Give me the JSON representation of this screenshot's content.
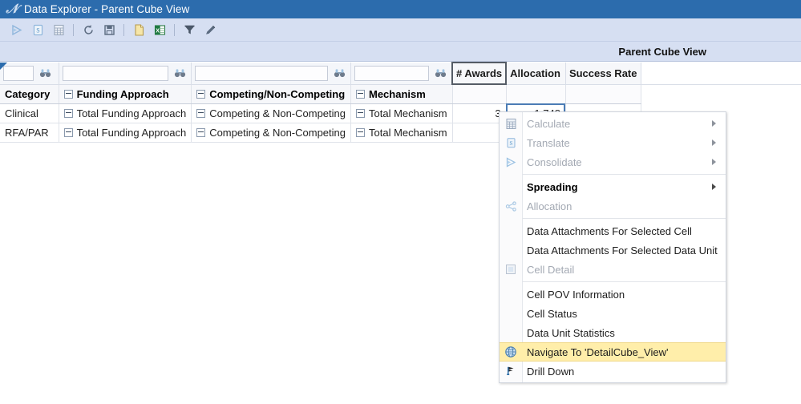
{
  "window": {
    "title": "Data Explorer - Parent Cube View",
    "logo_icon": "stylized-d-logo-icon"
  },
  "toolbar": {
    "buttons": [
      {
        "name": "consolidate-icon",
        "label": "Consolidate"
      },
      {
        "name": "translate-icon",
        "label": "Translate"
      },
      {
        "name": "calculate-icon",
        "label": "Calculate"
      },
      {
        "name": "refresh-icon",
        "label": "Refresh"
      },
      {
        "name": "save-icon",
        "label": "Save"
      },
      {
        "name": "export-document-icon",
        "label": "Export to Document"
      },
      {
        "name": "export-excel-icon",
        "label": "Export to Excel"
      },
      {
        "name": "filter-icon",
        "label": "Filter"
      },
      {
        "name": "edit-pencil-icon",
        "label": "Edit"
      }
    ]
  },
  "caption": {
    "text": "Parent Cube View"
  },
  "grid": {
    "filter_row": {
      "placeholder": "",
      "values": [
        "",
        "",
        "",
        ""
      ],
      "search_icon": "binoculars-icon"
    },
    "headers": [
      {
        "label": "Category",
        "collapsible": false
      },
      {
        "label": "Funding Approach",
        "collapsible": true
      },
      {
        "label": "Competing/Non-Competing",
        "collapsible": true
      },
      {
        "label": "Mechanism",
        "collapsible": true
      }
    ],
    "measures": [
      "# Awards",
      "Allocation",
      "Success Rate"
    ],
    "rows": [
      {
        "category": "Clinical",
        "funding_approach": "Total Funding Approach",
        "competing": "Competing & Non-Competing",
        "mechanism": "Total Mechanism",
        "awards": "3",
        "allocation": "1,748",
        "success_rate": ""
      },
      {
        "category": "RFA/PAR",
        "funding_approach": "Total Funding Approach",
        "competing": "Competing & Non-Competing",
        "mechanism": "Total Mechanism",
        "awards": "",
        "allocation": "",
        "success_rate": ""
      }
    ]
  },
  "context_menu": {
    "items": [
      {
        "label": "Calculate",
        "icon": "calculate-icon",
        "disabled": true,
        "submenu": true,
        "bold": false,
        "highlight": false
      },
      {
        "label": "Translate",
        "icon": "translate-icon",
        "disabled": true,
        "submenu": true,
        "bold": false,
        "highlight": false
      },
      {
        "label": "Consolidate",
        "icon": "consolidate-icon",
        "disabled": true,
        "submenu": true,
        "bold": false,
        "highlight": false
      },
      {
        "separator": true
      },
      {
        "label": "Spreading",
        "icon": "",
        "disabled": false,
        "submenu": true,
        "bold": true,
        "highlight": false
      },
      {
        "label": "Allocation",
        "icon": "allocation-icon",
        "disabled": true,
        "submenu": false,
        "bold": false,
        "highlight": false
      },
      {
        "separator": true
      },
      {
        "label": "Data Attachments For Selected Cell",
        "icon": "",
        "disabled": false,
        "submenu": false,
        "bold": false,
        "highlight": false
      },
      {
        "label": "Data Attachments For Selected Data Unit",
        "icon": "",
        "disabled": false,
        "submenu": false,
        "bold": false,
        "highlight": false
      },
      {
        "label": "Cell Detail",
        "icon": "cell-detail-icon",
        "disabled": true,
        "submenu": false,
        "bold": false,
        "highlight": false
      },
      {
        "separator": true
      },
      {
        "label": "Cell POV Information",
        "icon": "",
        "disabled": false,
        "submenu": false,
        "bold": false,
        "highlight": false
      },
      {
        "label": "Cell Status",
        "icon": "",
        "disabled": false,
        "submenu": false,
        "bold": false,
        "highlight": false
      },
      {
        "label": "Data Unit Statistics",
        "icon": "",
        "disabled": false,
        "submenu": false,
        "bold": false,
        "highlight": false
      },
      {
        "label": "Navigate To 'DetailCube_View'",
        "icon": "globe-navigate-icon",
        "disabled": false,
        "submenu": false,
        "bold": false,
        "highlight": true
      },
      {
        "label": "Drill Down",
        "icon": "drill-down-flag-icon",
        "disabled": false,
        "submenu": false,
        "bold": false,
        "highlight": false
      }
    ]
  },
  "colors": {
    "titlebar": "#2c6cad",
    "toolbar": "#d6dff2",
    "highlight": "#ffeeaa",
    "selection_border": "#4b7cb5"
  }
}
